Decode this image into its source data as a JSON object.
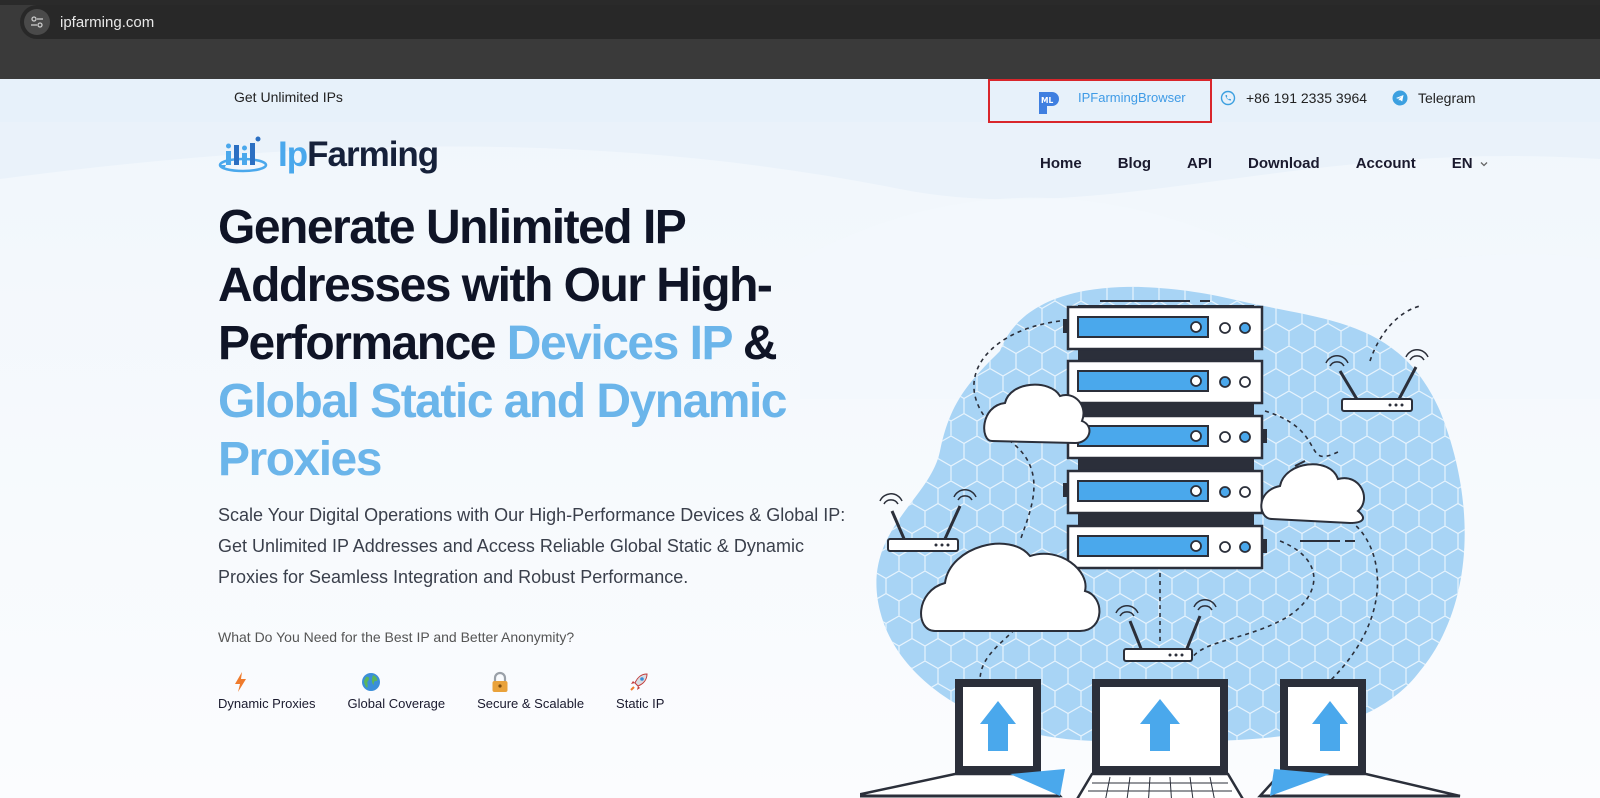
{
  "browser": {
    "url": "ipfarming.com"
  },
  "topbar": {
    "left_text": "Get Unlimited IPs",
    "promo_label": "IPFarmingBrowser",
    "promo_logo_text": "ML",
    "phone": "+86 191 2335 3964",
    "telegram": "Telegram"
  },
  "logo": {
    "part1": "Ip",
    "part2": "Farming"
  },
  "nav": {
    "items": [
      "Home",
      "Blog",
      "API",
      "Download",
      "Account"
    ],
    "language": "EN"
  },
  "hero": {
    "title_line1": "Generate Unlimited IP",
    "title_line2": "Addresses with Our High-",
    "title_line3a": "Performance ",
    "title_line3b": "Devices IP",
    "title_line3c": " &",
    "title_line4": "Global Static and Dynamic",
    "title_line5": "Proxies",
    "subtitle": "Scale Your Digital Operations with Our High-Performance Devices & Global IP: Get Unlimited IP Addresses and Access Reliable Global Static & Dynamic Proxies for Seamless Integration and Robust Performance.",
    "question": "What Do You Need for the Best IP and Better Anonymity?"
  },
  "features": [
    {
      "label": "Dynamic Proxies",
      "icon": "lightning-icon"
    },
    {
      "label": "Global Coverage",
      "icon": "globe-icon"
    },
    {
      "label": "Secure & Scalable",
      "icon": "lock-icon"
    },
    {
      "label": "Static IP",
      "icon": "rocket-icon"
    }
  ],
  "colors": {
    "accent": "#4aa8ec",
    "accent_light": "#6bb5ea",
    "dark": "#0f1426",
    "highlight_border": "#d9262b"
  }
}
